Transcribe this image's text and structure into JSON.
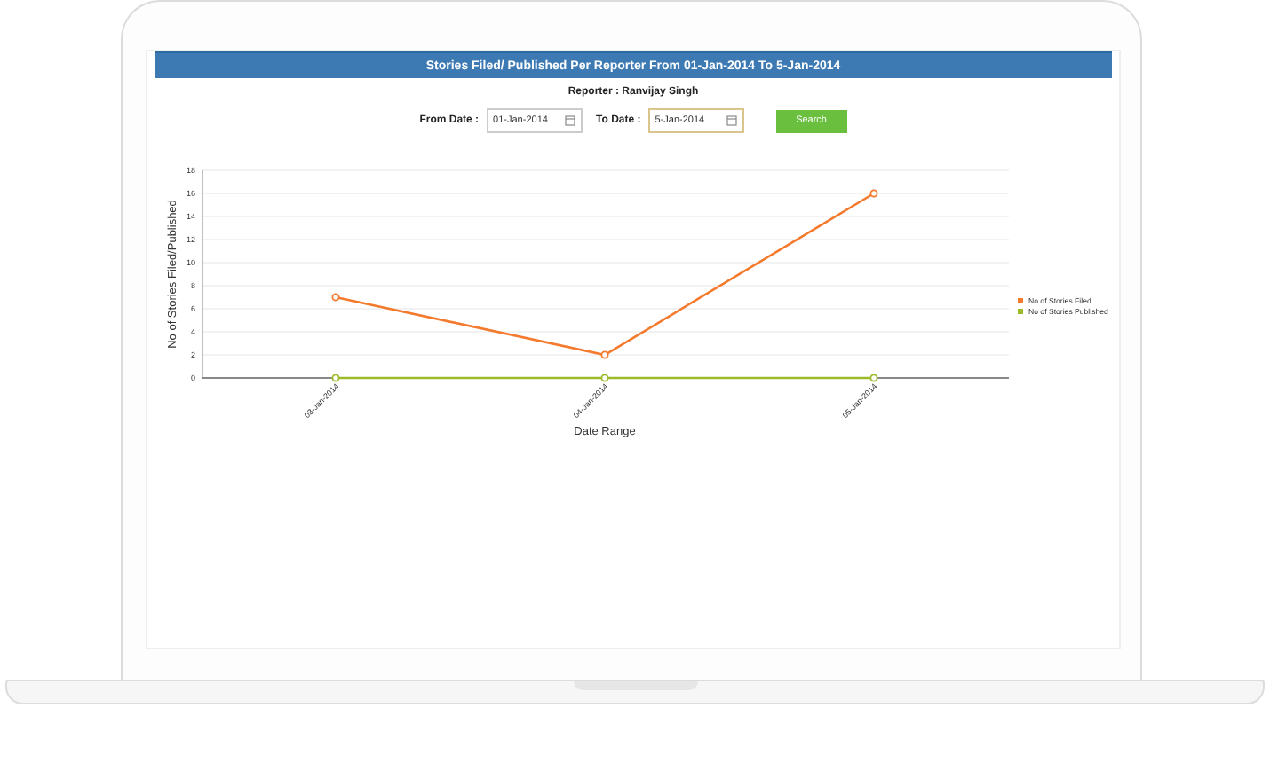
{
  "header": {
    "title": "Stories Filed/ Published Per Reporter From 01-Jan-2014 To 5-Jan-2014"
  },
  "reporter": "Reporter : Ranvijay Singh",
  "filters": [
    {
      "label": "From Date :",
      "value": "01-Jan-2014",
      "focused": false
    },
    {
      "label": "To Date :",
      "value": "5-Jan-2014",
      "focused": true
    }
  ],
  "search_button": "Search",
  "chart": {
    "chart_data": {
      "type": "line",
      "xlabel": "Date Range",
      "ylabel": "No of Stories Filed/Published",
      "categories": [
        "03-Jan-2014",
        "04-Jan-2014",
        "05-Jan-2014"
      ],
      "series": [
        {
          "name": "No of Stories Filed",
          "color": "#f47a2e",
          "marker": "circle",
          "values": [
            7,
            2,
            16
          ]
        },
        {
          "name": "No of Stories Published",
          "color": "#9bbb2a",
          "marker": "circle",
          "values": [
            0,
            0,
            0
          ]
        }
      ],
      "grid": true,
      "legend": true,
      "ylim": [
        0,
        18
      ],
      "yticks": [
        0,
        2,
        4,
        6,
        8,
        10,
        12,
        14,
        16,
        18
      ]
    }
  }
}
